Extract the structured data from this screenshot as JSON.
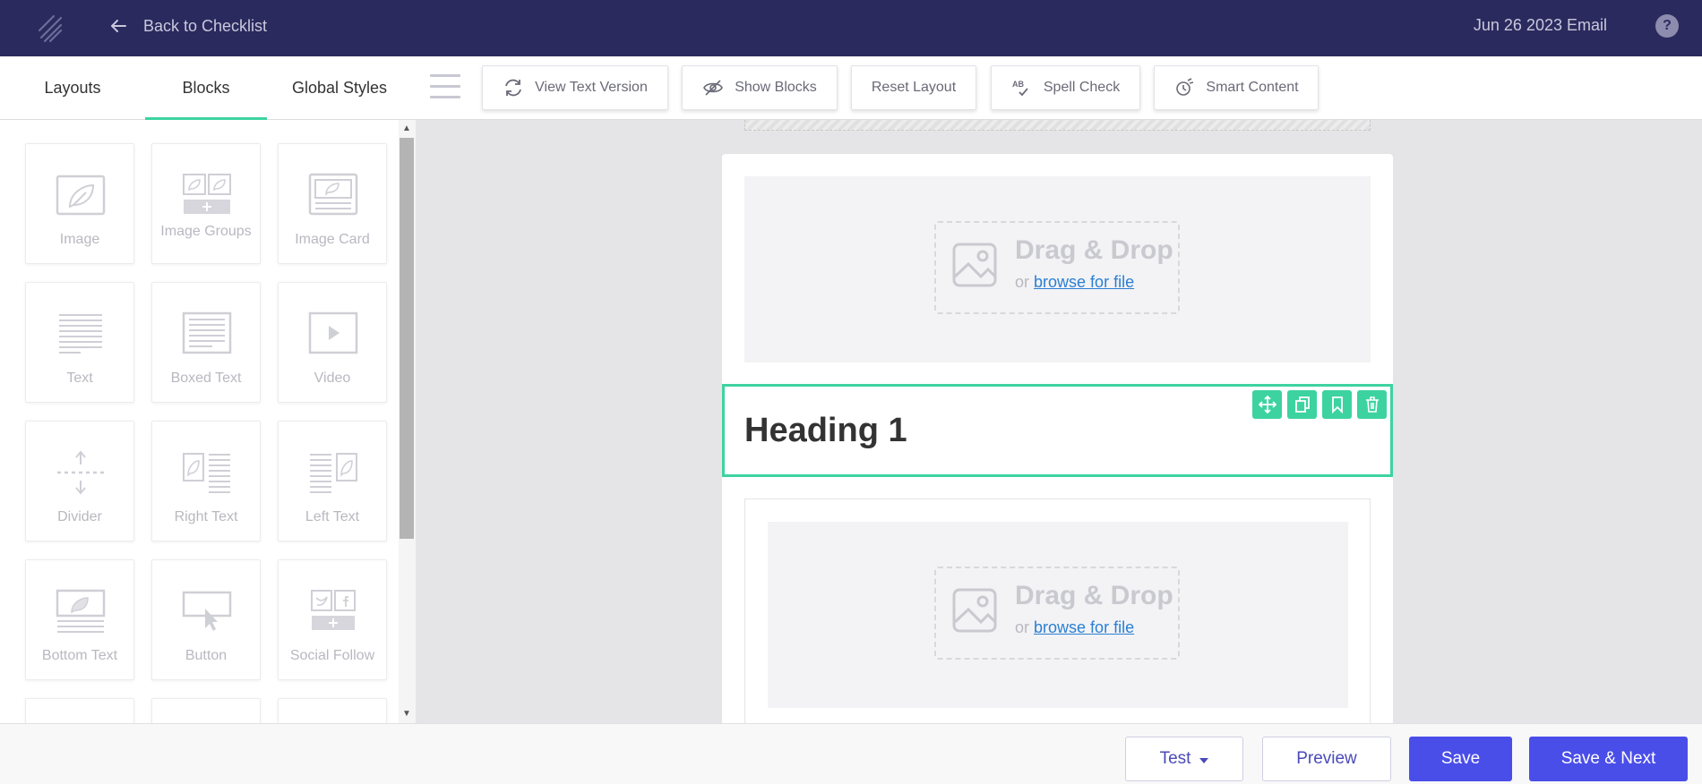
{
  "topbar": {
    "back_label": "Back to Checklist",
    "email_title": "Jun 26 2023 Email",
    "help_label": "?"
  },
  "tabs": [
    {
      "label": "Layouts"
    },
    {
      "label": "Blocks",
      "active": true
    },
    {
      "label": "Global Styles"
    }
  ],
  "toolbar": {
    "view_text": "View Text Version",
    "show_blocks": "Show Blocks",
    "reset_layout": "Reset Layout",
    "spell_check": "Spell Check",
    "smart_content": "Smart Content"
  },
  "blocks": [
    {
      "label": "Image",
      "icon": "image-icon"
    },
    {
      "label": "Image Groups",
      "icon": "image-groups-icon"
    },
    {
      "label": "Image Card",
      "icon": "image-card-icon"
    },
    {
      "label": "Text",
      "icon": "text-icon"
    },
    {
      "label": "Boxed Text",
      "icon": "boxed-text-icon"
    },
    {
      "label": "Video",
      "icon": "video-icon"
    },
    {
      "label": "Divider",
      "icon": "divider-icon"
    },
    {
      "label": "Right Text",
      "icon": "right-text-icon"
    },
    {
      "label": "Left Text",
      "icon": "left-text-icon"
    },
    {
      "label": "Bottom Text",
      "icon": "bottom-text-icon"
    },
    {
      "label": "Button",
      "icon": "button-icon"
    },
    {
      "label": "Social Follow",
      "icon": "social-follow-icon"
    }
  ],
  "canvas": {
    "dropzone_title": "Drag & Drop",
    "dropzone_or": "or",
    "dropzone_link": "browse for file",
    "heading": "Heading 1"
  },
  "footer": {
    "test_label": "Test",
    "preview_label": "Preview",
    "save_label": "Save",
    "save_next_label": "Save & Next"
  },
  "colors": {
    "topbar": "#2b2a5e",
    "accent_green": "#3dd3a0",
    "primary_blue": "#4a4ee8"
  }
}
